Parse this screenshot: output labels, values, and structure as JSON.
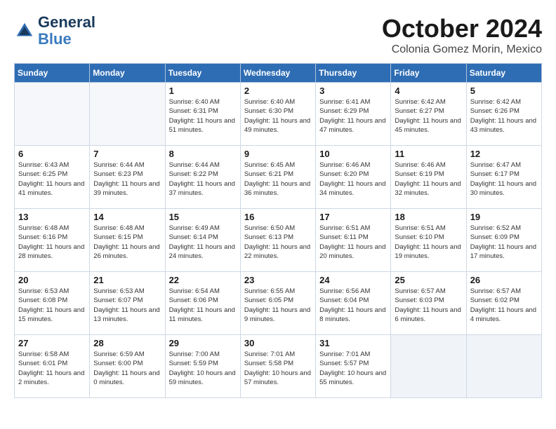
{
  "logo": {
    "line1": "General",
    "line2": "Blue"
  },
  "header": {
    "month": "October 2024",
    "location": "Colonia Gomez Morin, Mexico"
  },
  "weekdays": [
    "Sunday",
    "Monday",
    "Tuesday",
    "Wednesday",
    "Thursday",
    "Friday",
    "Saturday"
  ],
  "weeks": [
    [
      {
        "day": "",
        "detail": ""
      },
      {
        "day": "",
        "detail": ""
      },
      {
        "day": "1",
        "detail": "Sunrise: 6:40 AM\nSunset: 6:31 PM\nDaylight: 11 hours and 51 minutes."
      },
      {
        "day": "2",
        "detail": "Sunrise: 6:40 AM\nSunset: 6:30 PM\nDaylight: 11 hours and 49 minutes."
      },
      {
        "day": "3",
        "detail": "Sunrise: 6:41 AM\nSunset: 6:29 PM\nDaylight: 11 hours and 47 minutes."
      },
      {
        "day": "4",
        "detail": "Sunrise: 6:42 AM\nSunset: 6:27 PM\nDaylight: 11 hours and 45 minutes."
      },
      {
        "day": "5",
        "detail": "Sunrise: 6:42 AM\nSunset: 6:26 PM\nDaylight: 11 hours and 43 minutes."
      }
    ],
    [
      {
        "day": "6",
        "detail": "Sunrise: 6:43 AM\nSunset: 6:25 PM\nDaylight: 11 hours and 41 minutes."
      },
      {
        "day": "7",
        "detail": "Sunrise: 6:44 AM\nSunset: 6:23 PM\nDaylight: 11 hours and 39 minutes."
      },
      {
        "day": "8",
        "detail": "Sunrise: 6:44 AM\nSunset: 6:22 PM\nDaylight: 11 hours and 37 minutes."
      },
      {
        "day": "9",
        "detail": "Sunrise: 6:45 AM\nSunset: 6:21 PM\nDaylight: 11 hours and 36 minutes."
      },
      {
        "day": "10",
        "detail": "Sunrise: 6:46 AM\nSunset: 6:20 PM\nDaylight: 11 hours and 34 minutes."
      },
      {
        "day": "11",
        "detail": "Sunrise: 6:46 AM\nSunset: 6:19 PM\nDaylight: 11 hours and 32 minutes."
      },
      {
        "day": "12",
        "detail": "Sunrise: 6:47 AM\nSunset: 6:17 PM\nDaylight: 11 hours and 30 minutes."
      }
    ],
    [
      {
        "day": "13",
        "detail": "Sunrise: 6:48 AM\nSunset: 6:16 PM\nDaylight: 11 hours and 28 minutes."
      },
      {
        "day": "14",
        "detail": "Sunrise: 6:48 AM\nSunset: 6:15 PM\nDaylight: 11 hours and 26 minutes."
      },
      {
        "day": "15",
        "detail": "Sunrise: 6:49 AM\nSunset: 6:14 PM\nDaylight: 11 hours and 24 minutes."
      },
      {
        "day": "16",
        "detail": "Sunrise: 6:50 AM\nSunset: 6:13 PM\nDaylight: 11 hours and 22 minutes."
      },
      {
        "day": "17",
        "detail": "Sunrise: 6:51 AM\nSunset: 6:11 PM\nDaylight: 11 hours and 20 minutes."
      },
      {
        "day": "18",
        "detail": "Sunrise: 6:51 AM\nSunset: 6:10 PM\nDaylight: 11 hours and 19 minutes."
      },
      {
        "day": "19",
        "detail": "Sunrise: 6:52 AM\nSunset: 6:09 PM\nDaylight: 11 hours and 17 minutes."
      }
    ],
    [
      {
        "day": "20",
        "detail": "Sunrise: 6:53 AM\nSunset: 6:08 PM\nDaylight: 11 hours and 15 minutes."
      },
      {
        "day": "21",
        "detail": "Sunrise: 6:53 AM\nSunset: 6:07 PM\nDaylight: 11 hours and 13 minutes."
      },
      {
        "day": "22",
        "detail": "Sunrise: 6:54 AM\nSunset: 6:06 PM\nDaylight: 11 hours and 11 minutes."
      },
      {
        "day": "23",
        "detail": "Sunrise: 6:55 AM\nSunset: 6:05 PM\nDaylight: 11 hours and 9 minutes."
      },
      {
        "day": "24",
        "detail": "Sunrise: 6:56 AM\nSunset: 6:04 PM\nDaylight: 11 hours and 8 minutes."
      },
      {
        "day": "25",
        "detail": "Sunrise: 6:57 AM\nSunset: 6:03 PM\nDaylight: 11 hours and 6 minutes."
      },
      {
        "day": "26",
        "detail": "Sunrise: 6:57 AM\nSunset: 6:02 PM\nDaylight: 11 hours and 4 minutes."
      }
    ],
    [
      {
        "day": "27",
        "detail": "Sunrise: 6:58 AM\nSunset: 6:01 PM\nDaylight: 11 hours and 2 minutes."
      },
      {
        "day": "28",
        "detail": "Sunrise: 6:59 AM\nSunset: 6:00 PM\nDaylight: 11 hours and 0 minutes."
      },
      {
        "day": "29",
        "detail": "Sunrise: 7:00 AM\nSunset: 5:59 PM\nDaylight: 10 hours and 59 minutes."
      },
      {
        "day": "30",
        "detail": "Sunrise: 7:01 AM\nSunset: 5:58 PM\nDaylight: 10 hours and 57 minutes."
      },
      {
        "day": "31",
        "detail": "Sunrise: 7:01 AM\nSunset: 5:57 PM\nDaylight: 10 hours and 55 minutes."
      },
      {
        "day": "",
        "detail": ""
      },
      {
        "day": "",
        "detail": ""
      }
    ]
  ]
}
